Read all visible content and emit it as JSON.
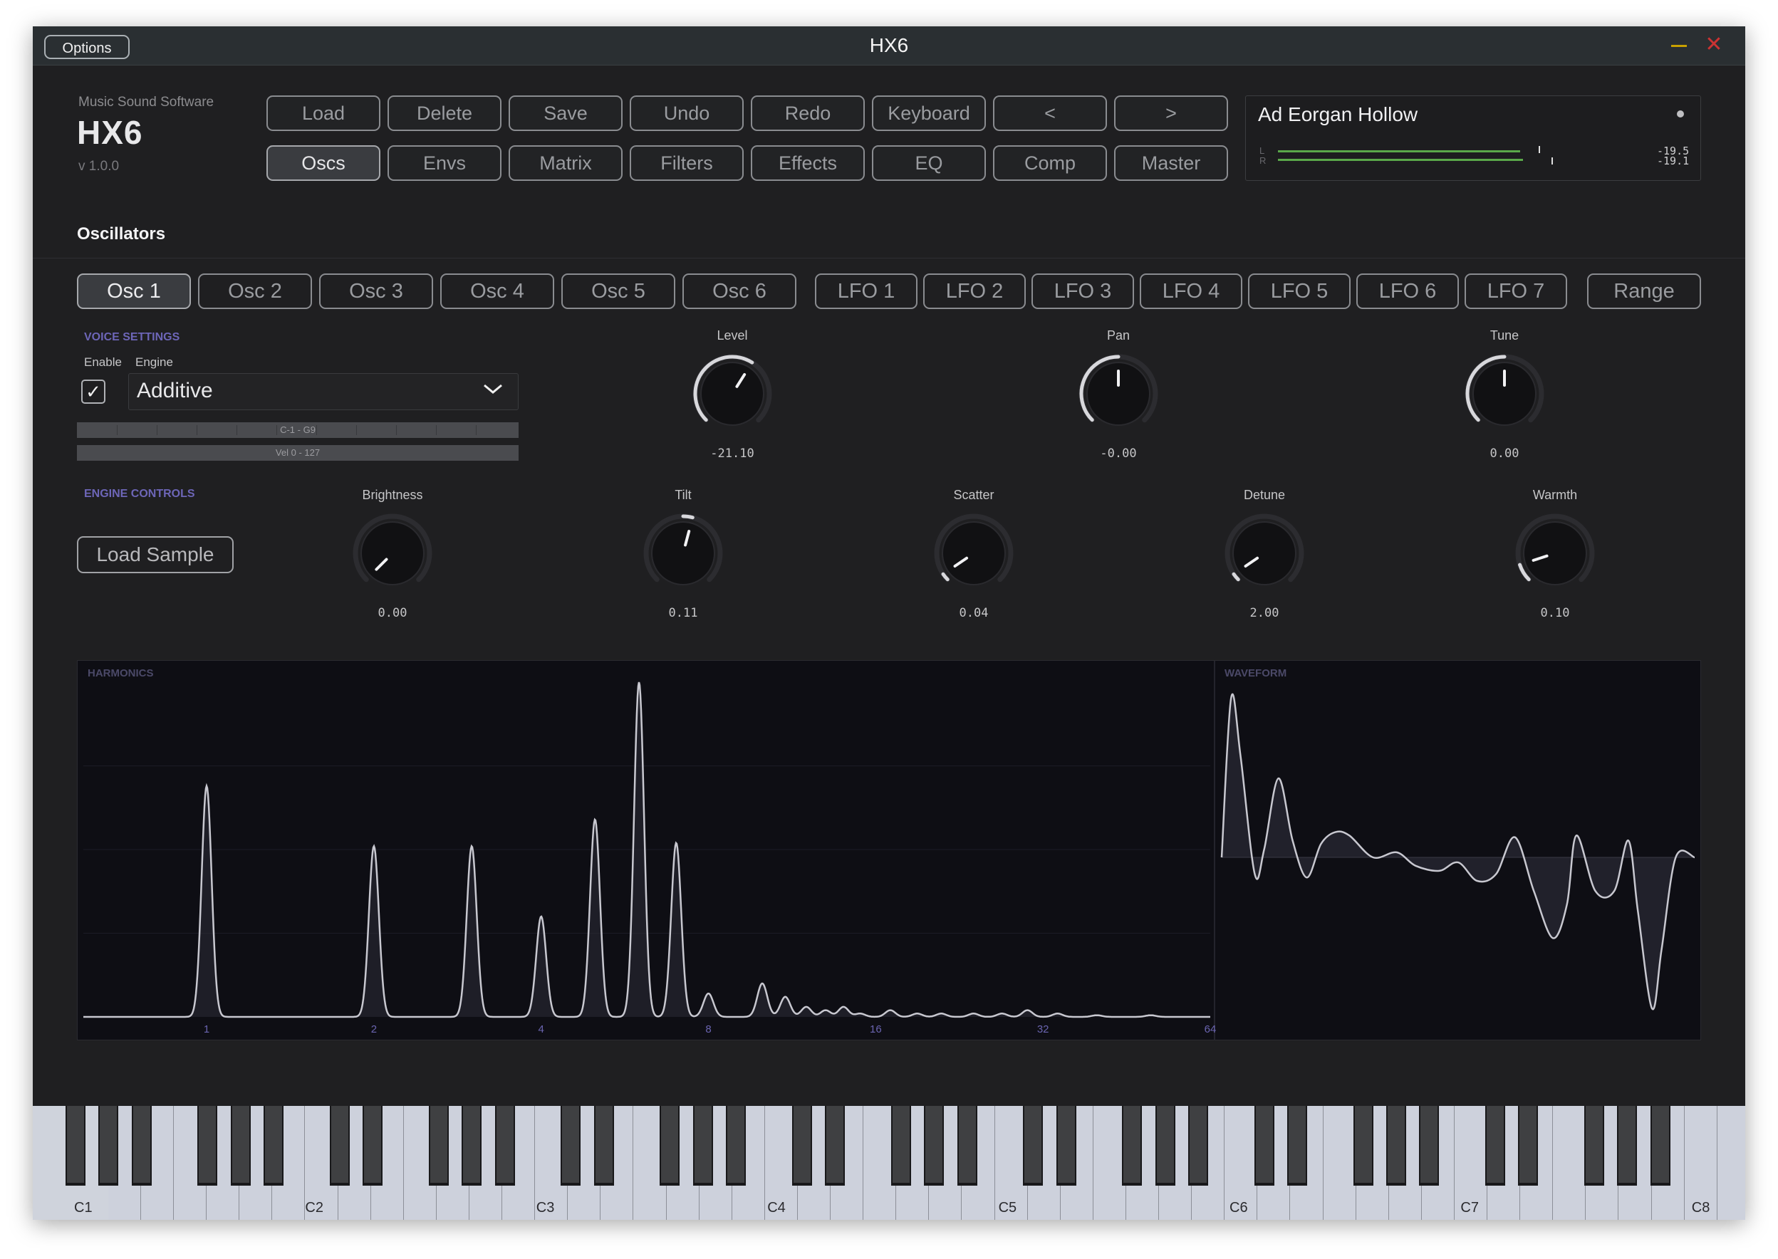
{
  "window": {
    "title": "HX6",
    "options_label": "Options"
  },
  "brand": {
    "vendor": "Music Sound Software",
    "logo": "HX6",
    "version": "v 1.0.0"
  },
  "toolbar_row1": [
    "Load",
    "Delete",
    "Save",
    "Undo",
    "Redo",
    "Keyboard",
    "<",
    ">"
  ],
  "toolbar_row2": [
    "Oscs",
    "Envs",
    "Matrix",
    "Filters",
    "Effects",
    "EQ",
    "Comp",
    "Master"
  ],
  "toolbar_selected": "Oscs",
  "preset": {
    "name": "Ad Eorgan Hollow",
    "meter_l_label": "L",
    "meter_r_label": "R",
    "meter_l_value": "-19.5",
    "meter_r_value": "-19.1"
  },
  "section_title": "Oscillators",
  "osc_tabs": [
    "Osc 1",
    "Osc 2",
    "Osc 3",
    "Osc 4",
    "Osc 5",
    "Osc 6"
  ],
  "lfo_tabs": [
    "LFO 1",
    "LFO 2",
    "LFO 3",
    "LFO 4",
    "LFO 5",
    "LFO 6",
    "LFO 7"
  ],
  "range_tab": "Range",
  "selected_tab": "Osc 1",
  "voice": {
    "heading": "VOICE SETTINGS",
    "enable_label": "Enable",
    "engine_label": "Engine",
    "engine_value": "Additive",
    "enabled": true,
    "key_range": "C-1 - G9",
    "vel_range": "Vel 0 - 127"
  },
  "main_knobs": [
    {
      "label": "Level",
      "value": "-21.10",
      "amount": 0.62
    },
    {
      "label": "Pan",
      "value": "-0.00",
      "amount": 0.5
    },
    {
      "label": "Tune",
      "value": "0.00",
      "amount": 0.5
    }
  ],
  "engine": {
    "heading": "ENGINE CONTROLS",
    "load_sample": "Load Sample"
  },
  "engine_knobs": [
    {
      "label": "Brightness",
      "value": "0.00",
      "amount": 0.0
    },
    {
      "label": "Tilt",
      "value": "0.11",
      "amount": 0.555
    },
    {
      "label": "Scatter",
      "value": "0.04",
      "amount": 0.04
    },
    {
      "label": "Detune",
      "value": "2.00",
      "amount": 0.04
    },
    {
      "label": "Warmth",
      "value": "0.10",
      "amount": 0.1
    }
  ],
  "graphs": {
    "harmonics_label": "HARMONICS",
    "waveform_label": "WAVEFORM",
    "x_ticks": [
      "1",
      "2",
      "4",
      "8",
      "16",
      "32",
      "64"
    ]
  },
  "chart_data": [
    {
      "type": "line",
      "title": "HARMONICS",
      "x_scale": "log2",
      "x_ticks": [
        "1",
        "2",
        "4",
        "8",
        "16",
        "32",
        "64"
      ],
      "xlim": [
        0.6,
        64
      ],
      "ylim": [
        0,
        1
      ],
      "peaks": [
        {
          "x": 1.0,
          "y": 0.69
        },
        {
          "x": 2.0,
          "y": 0.51
        },
        {
          "x": 3.0,
          "y": 0.51
        },
        {
          "x": 4.0,
          "y": 0.3
        },
        {
          "x": 5.0,
          "y": 0.59
        },
        {
          "x": 6.0,
          "y": 1.0
        },
        {
          "x": 7.0,
          "y": 0.52
        },
        {
          "x": 8.0,
          "y": 0.07
        },
        {
          "x": 10.0,
          "y": 0.1
        },
        {
          "x": 11.0,
          "y": 0.06
        },
        {
          "x": 12.0,
          "y": 0.03
        },
        {
          "x": 13.0,
          "y": 0.02
        },
        {
          "x": 14.0,
          "y": 0.03
        },
        {
          "x": 15.0,
          "y": 0.01
        },
        {
          "x": 17.0,
          "y": 0.02
        },
        {
          "x": 19.0,
          "y": 0.01
        },
        {
          "x": 21.0,
          "y": 0.01
        },
        {
          "x": 24.0,
          "y": 0.01
        },
        {
          "x": 27.0,
          "y": 0.01
        },
        {
          "x": 30.0,
          "y": 0.02
        },
        {
          "x": 34.0,
          "y": 0.01
        },
        {
          "x": 40.0,
          "y": 0.005
        },
        {
          "x": 50.0,
          "y": 0.005
        }
      ],
      "grid": true
    },
    {
      "type": "area",
      "title": "WAVEFORM",
      "xlim": [
        0,
        1
      ],
      "ylim": [
        -1,
        1
      ],
      "x": [
        0.0,
        0.02,
        0.04,
        0.07,
        0.09,
        0.12,
        0.15,
        0.18,
        0.21,
        0.24,
        0.27,
        0.32,
        0.37,
        0.41,
        0.46,
        0.5,
        0.54,
        0.58,
        0.62,
        0.66,
        0.7,
        0.73,
        0.75,
        0.79,
        0.83,
        0.86,
        0.88,
        0.91,
        0.93,
        0.96,
        1.0
      ],
      "y": [
        0.0,
        0.95,
        0.6,
        -0.1,
        0.05,
        0.47,
        0.1,
        -0.12,
        0.08,
        0.15,
        0.13,
        0.0,
        0.03,
        -0.05,
        -0.08,
        -0.03,
        -0.14,
        -0.1,
        0.12,
        -0.2,
        -0.48,
        -0.28,
        0.13,
        -0.2,
        -0.2,
        0.1,
        -0.32,
        -0.9,
        -0.55,
        0.0,
        0.0
      ]
    }
  ],
  "keyboard": {
    "octave_labels": [
      "C1",
      "C2",
      "C3",
      "C4",
      "C5",
      "C6",
      "C7",
      "C8"
    ]
  },
  "colors": {
    "accent": "#6d66b8",
    "meter": "#5aa84a",
    "background": "#1f1f21",
    "close": "#cc3333",
    "minimize": "#c8a100"
  }
}
